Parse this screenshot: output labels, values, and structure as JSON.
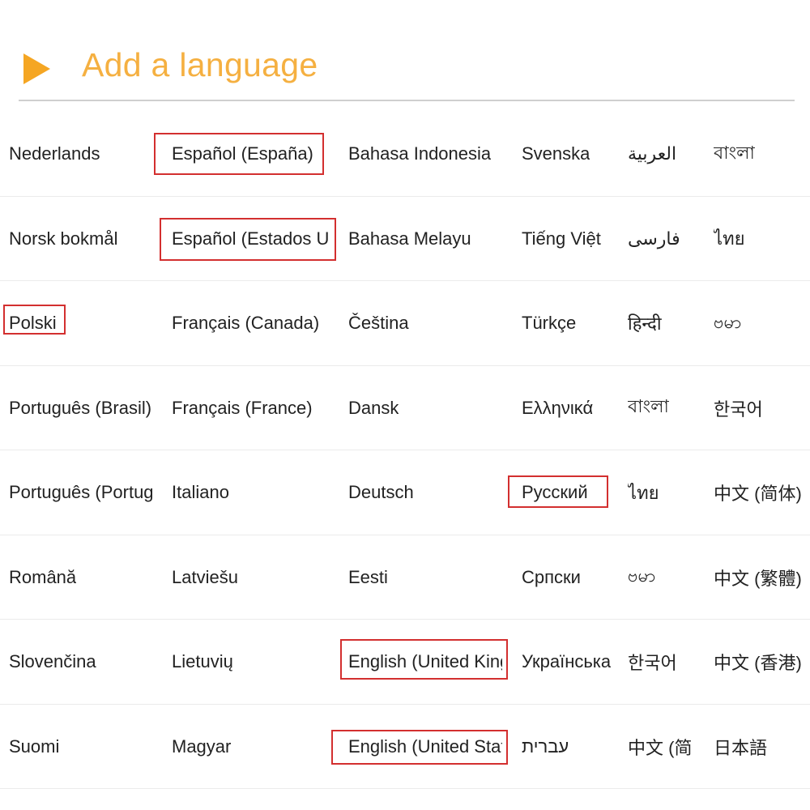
{
  "header": {
    "title": "Add a language",
    "accent_color": "#F5A623",
    "icon": "play-triangle-icon"
  },
  "languages": [
    [
      "Nederlands",
      "Español (España)",
      "Bahasa Indonesia",
      "Svenska",
      "العربية",
      "বাংলা"
    ],
    [
      "Norsk bokmål",
      "Español (Estados Unidos)",
      "Bahasa Melayu",
      "Tiếng Việt",
      "فارسی",
      "ไทย"
    ],
    [
      "Polski",
      "Français (Canada)",
      "Čeština",
      "Türkçe",
      "हिन्दी",
      "ဗမာ"
    ],
    [
      "Português (Brasil)",
      "Français (France)",
      "Dansk",
      "Ελληνικά",
      "বাংলা",
      "한국어"
    ],
    [
      "Português (Portugal)",
      "Italiano",
      "Deutsch",
      "Русский",
      "ไทย",
      "中文 (简体)"
    ],
    [
      "Română",
      "Latviešu",
      "Eesti",
      "Српски",
      "ဗမာ",
      "中文 (繁體)"
    ],
    [
      "Slovenčina",
      "Lietuvių",
      "English (United Kingdom)",
      "Українська",
      "한국어",
      "中文 (香港)"
    ],
    [
      "Suomi",
      "Magyar",
      "English (United States)",
      "עברית",
      "中文 (简",
      "日本語"
    ]
  ],
  "highlight_color": "#d32f2f"
}
